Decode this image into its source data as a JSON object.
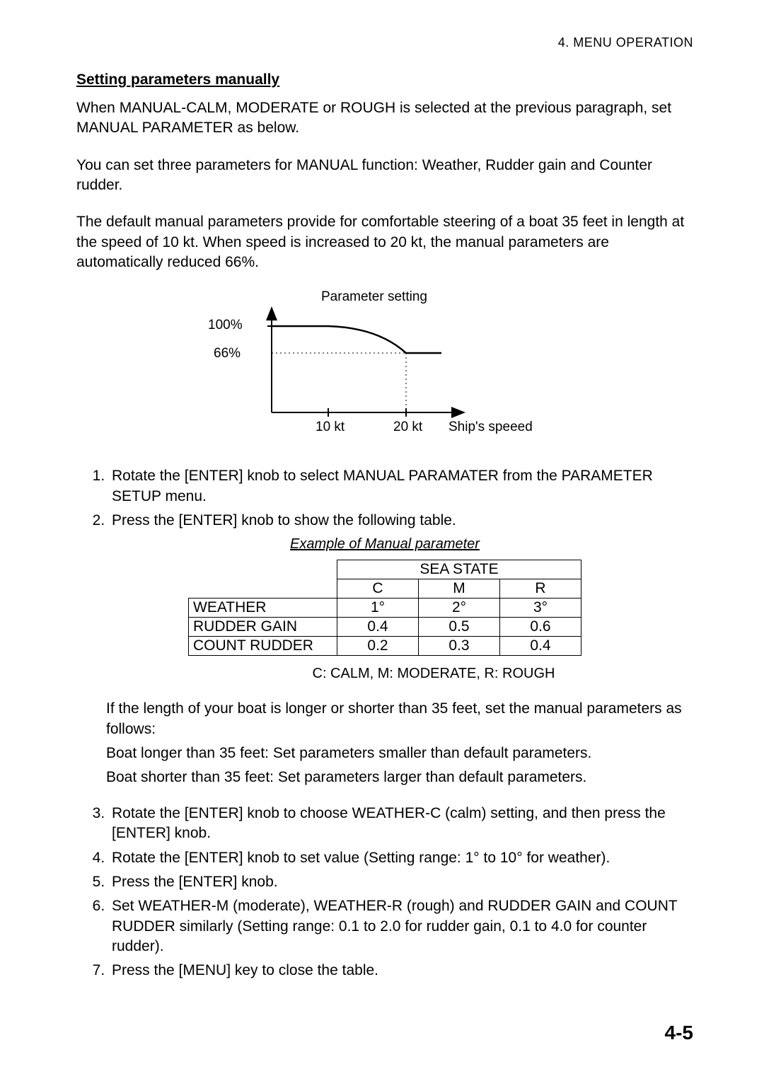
{
  "header": {
    "chapter": "4.  MENU  OPERATION"
  },
  "section": {
    "title": "Setting parameters manually",
    "p1": "When MANUAL-CALM, MODERATE or ROUGH is selected at the previous paragraph, set MANUAL PARAMETER as below.",
    "p2": "You can set three parameters for MANUAL function: Weather, Rudder gain and Counter rudder.",
    "p3": "The default manual parameters provide for comfortable steering of a boat 35 feet in length at the speed of 10 kt. When speed is increased to 20 kt, the manual parameters are automatically reduced 66%."
  },
  "chart": {
    "caption": "Parameter setting",
    "y100": "100%",
    "y66": "66%",
    "x10": "10 kt",
    "x20": "20 kt",
    "xlabel": "Ship's speeed"
  },
  "chart_data": {
    "type": "line",
    "title": "Parameter setting",
    "xlabel": "Ship's speeed",
    "ylabel": "",
    "x": [
      "10 kt",
      "20 kt"
    ],
    "y_ticks": [
      "66%",
      "100%"
    ],
    "series": [
      {
        "name": "Parameter setting",
        "values": [
          100,
          66
        ]
      }
    ],
    "note": "Curve: 100% up to 10 kt, decreasing to 66% at 20 kt, then flat"
  },
  "steps": {
    "s1": "Rotate the [ENTER] knob to select MANUAL PARAMATER from the PARAMETER SETUP menu.",
    "s2": "Press the [ENTER] knob to show the following table.",
    "s3": "Rotate the [ENTER] knob to choose WEATHER-C (calm) setting, and then press the [ENTER] knob.",
    "s4": "Rotate the [ENTER] knob to set value (Setting range: 1° to 10° for weather).",
    "s5": "Press the [ENTER] knob.",
    "s6": "Set WEATHER-M (moderate), WEATHER-R (rough) and RUDDER GAIN and COUNT RUDDER similarly (Setting range: 0.1 to 2.0 for rudder gain, 0.1 to 4.0 for counter rudder).",
    "s7": "Press the [MENU] key to close the table."
  },
  "table": {
    "caption": "Example of Manual parameter",
    "header_group": "SEA STATE",
    "cols": {
      "c": "C",
      "m": "M",
      "r": "R"
    },
    "rows": [
      {
        "name": "WEATHER",
        "c": "1°",
        "m": "2°",
        "r": "3°"
      },
      {
        "name": "RUDDER GAIN",
        "c": "0.4",
        "m": "0.5",
        "r": "0.6"
      },
      {
        "name": "COUNT RUDDER",
        "c": "0.2",
        "m": "0.3",
        "r": "0.4"
      }
    ],
    "legend": "C: CALM, M: MODERATE, R: ROUGH"
  },
  "guidance": {
    "intro": "If the length of your boat is longer or shorter than 35 feet, set the manual parameters as follows:",
    "longer": "Boat longer than 35 feet: Set parameters smaller than default parameters.",
    "shorter": "Boat shorter than 35 feet: Set parameters larger than default parameters."
  },
  "page_number": "4-5"
}
